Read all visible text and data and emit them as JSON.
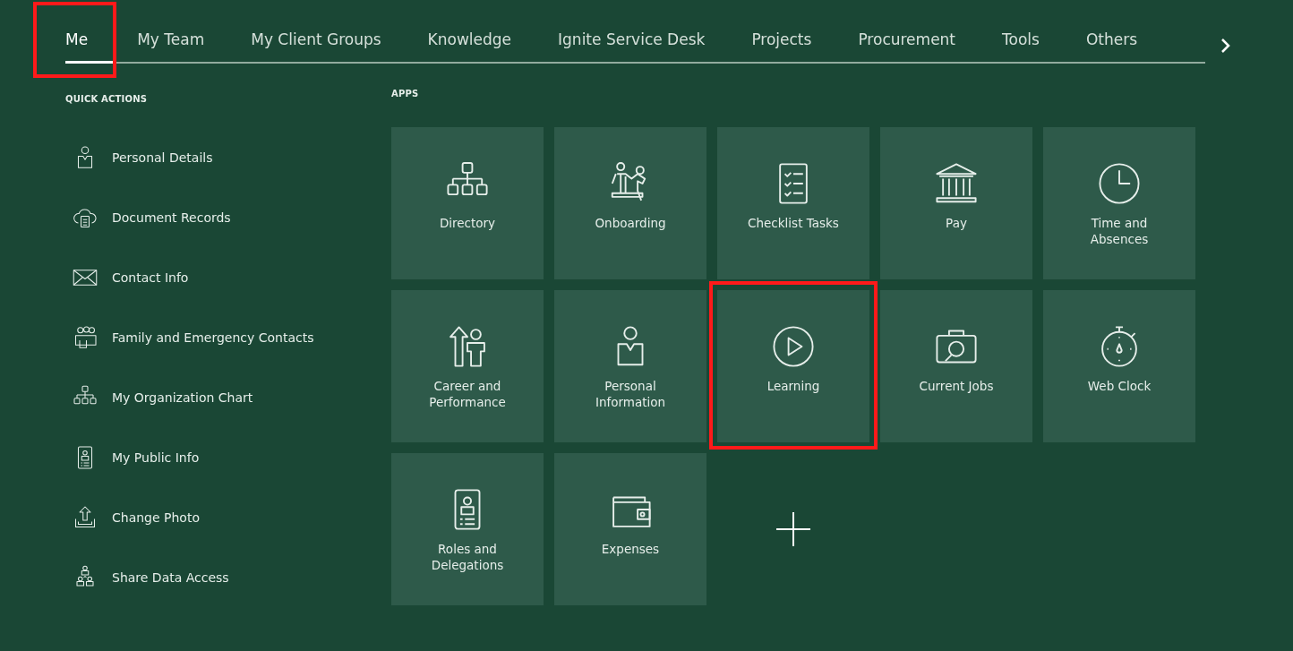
{
  "tabs": [
    {
      "label": "Me",
      "selected": true,
      "highlighted": true
    },
    {
      "label": "My Team",
      "selected": false,
      "highlighted": false
    },
    {
      "label": "My Client Groups",
      "selected": false,
      "highlighted": false
    },
    {
      "label": "Knowledge",
      "selected": false,
      "highlighted": false
    },
    {
      "label": "Ignite Service Desk",
      "selected": false,
      "highlighted": false
    },
    {
      "label": "Projects",
      "selected": false,
      "highlighted": false
    },
    {
      "label": "Procurement",
      "selected": false,
      "highlighted": false
    },
    {
      "label": "Tools",
      "selected": false,
      "highlighted": false
    },
    {
      "label": "Others",
      "selected": false,
      "highlighted": false
    }
  ],
  "quick_actions": {
    "title": "QUICK ACTIONS",
    "items": [
      {
        "label": "Personal Details"
      },
      {
        "label": "Document Records"
      },
      {
        "label": "Contact Info"
      },
      {
        "label": "Family and Emergency Contacts"
      },
      {
        "label": "My Organization Chart"
      },
      {
        "label": "My Public Info"
      },
      {
        "label": "Change Photo"
      },
      {
        "label": "Share Data Access"
      }
    ]
  },
  "apps": {
    "title": "APPS",
    "tiles": [
      {
        "label": "Directory",
        "highlighted": false
      },
      {
        "label": "Onboarding",
        "highlighted": false
      },
      {
        "label": "Checklist Tasks",
        "highlighted": false
      },
      {
        "label": "Pay",
        "highlighted": false
      },
      {
        "label": "Time and Absences",
        "highlighted": false
      },
      {
        "label": "Career and Performance",
        "highlighted": false
      },
      {
        "label": "Personal Information",
        "highlighted": false
      },
      {
        "label": "Learning",
        "highlighted": true
      },
      {
        "label": "Current Jobs",
        "highlighted": false
      },
      {
        "label": "Web Clock",
        "highlighted": false
      },
      {
        "label": "Roles and Delegations",
        "highlighted": false
      },
      {
        "label": "Expenses",
        "highlighted": false
      }
    ]
  }
}
